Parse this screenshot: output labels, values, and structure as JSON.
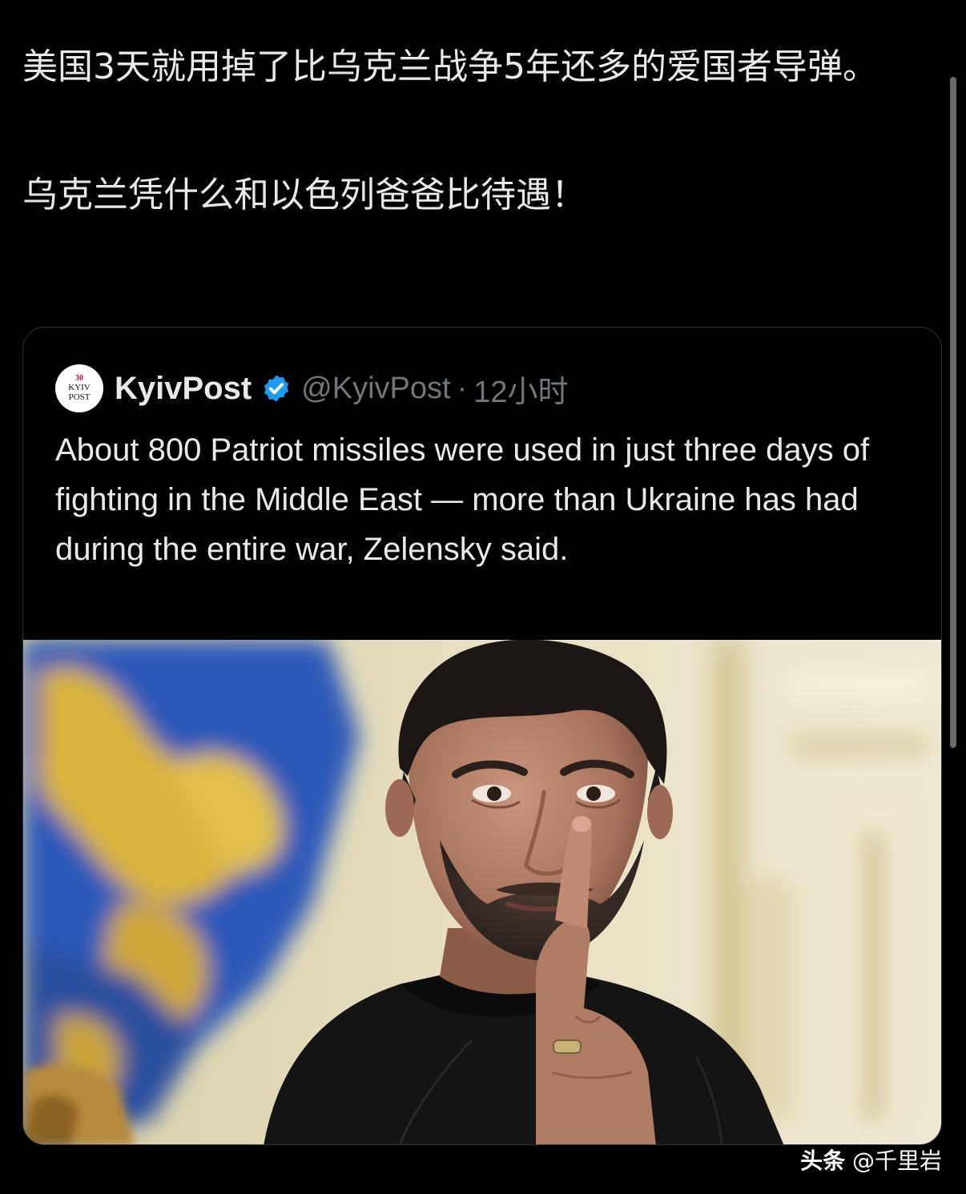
{
  "tweet": {
    "lines": [
      "美国3天就用掉了比乌克兰战争5年还多的爱国者导弹。",
      "乌克兰凭什么和以色列爸爸比待遇！"
    ]
  },
  "quote": {
    "avatar": {
      "number": "30",
      "line1": "KYIV",
      "line2": "POST"
    },
    "name": "KyivPost",
    "handle": "@KyivPost",
    "separator": "·",
    "time": "12小时",
    "text": "About 800 Patriot missiles were used in just three days of fighting in the Middle East — more than Ukraine has had during the entire war, Zelensky said.",
    "verified_color": "#1d9bf0"
  },
  "watermark": {
    "brand": "头条",
    "author": "@千里岩"
  },
  "colors": {
    "background": "#000000",
    "text": "#e7e9ea",
    "muted": "#71767b",
    "border": "#2f3336"
  },
  "icons": {
    "verified": "verified-badge-icon",
    "avatar": "kyivpost-logo"
  }
}
